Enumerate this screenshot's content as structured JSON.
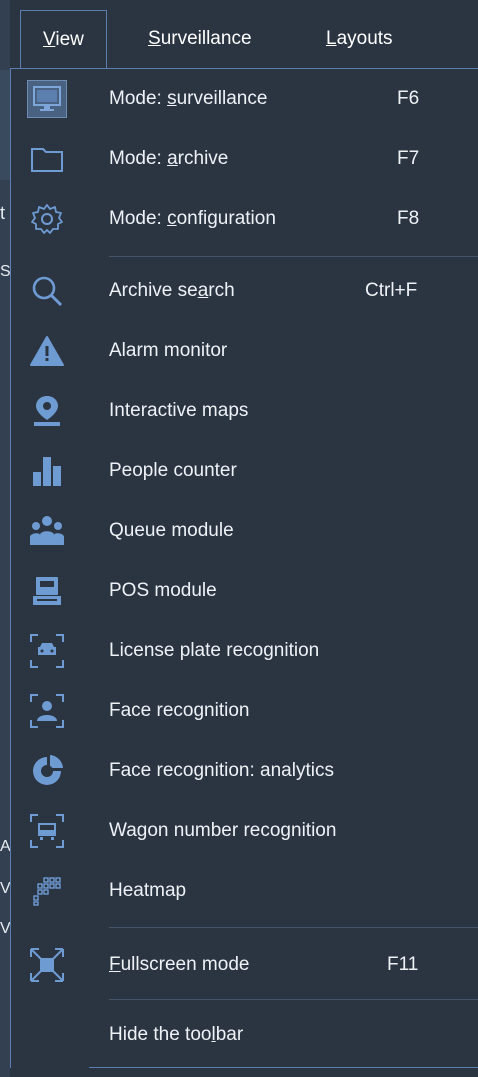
{
  "menubar": [
    {
      "label": "View",
      "underline": "V",
      "rest": "iew"
    },
    {
      "label": "Surveillance",
      "underline": "S",
      "rest": "urveillance"
    },
    {
      "label": "Layouts",
      "underline": "L",
      "rest": "ayouts"
    }
  ],
  "menu": {
    "group1": [
      {
        "pre": "Mode: ",
        "u": "s",
        "post": "urveillance",
        "key": "F6",
        "icon": "monitor-icon"
      },
      {
        "pre": "Mode: ",
        "u": "a",
        "post": "rchive",
        "key": "F7",
        "icon": "folder-icon"
      },
      {
        "pre": "Mode: ",
        "u": "c",
        "post": "onfiguration",
        "key": "F8",
        "icon": "gear-icon"
      }
    ],
    "group2": [
      {
        "pre": "Archive se",
        "u": "a",
        "post": "rch",
        "key": "Ctrl+F",
        "icon": "search-icon"
      },
      {
        "label": "Alarm monitor",
        "icon": "alarm-icon"
      },
      {
        "label": "Interactive maps",
        "icon": "map-pin-icon"
      },
      {
        "label": "People counter",
        "icon": "bar-chart-icon"
      },
      {
        "label": "Queue module",
        "icon": "people-group-icon"
      },
      {
        "label": "POS module",
        "icon": "pos-terminal-icon"
      },
      {
        "label": "License plate recognition",
        "icon": "car-recognition-icon"
      },
      {
        "label": "Face recognition",
        "icon": "face-recognition-icon"
      },
      {
        "label": "Face recognition: analytics",
        "icon": "pie-chart-icon"
      },
      {
        "label": "Wagon number recognition",
        "icon": "wagon-recognition-icon"
      },
      {
        "label": "Heatmap",
        "icon": "heatmap-icon"
      }
    ],
    "group3": [
      {
        "pre": "",
        "u": "F",
        "post": "ullscreen mode",
        "key": "F11",
        "icon": "fullscreen-icon"
      }
    ],
    "group4": [
      {
        "pre": "Hide the too",
        "u": "l",
        "post": "bar"
      }
    ]
  },
  "behind_chars": [
    "t",
    "S",
    "A",
    "V",
    "V"
  ],
  "colors": {
    "bg": "#2b3542",
    "accent": "#5a7fae",
    "icon": "#6f9bd3"
  }
}
